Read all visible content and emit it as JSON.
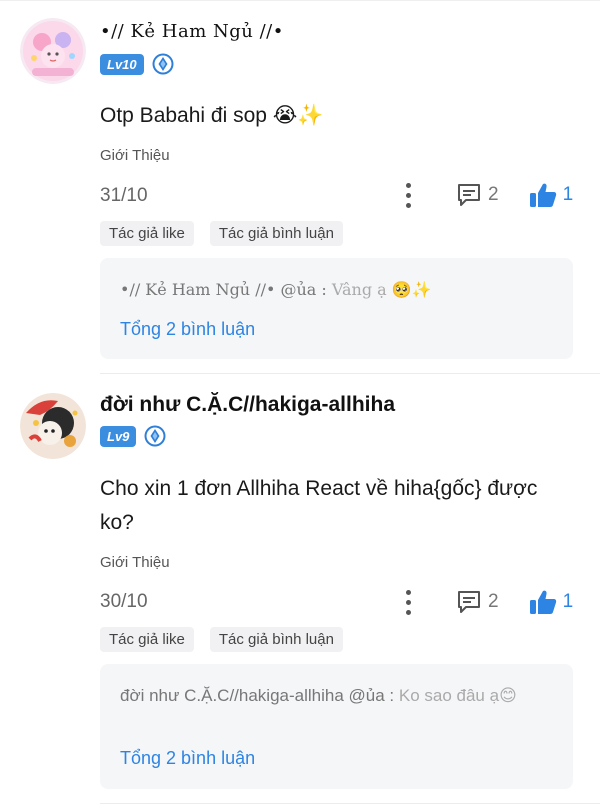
{
  "comments": [
    {
      "username": "•// Kẻ Ham Ngủ //•",
      "level": "Lv10",
      "content": "Otp Babahi đi sop 😭✨",
      "intro": "Giới Thiệu",
      "date": "31/10",
      "comment_count": "2",
      "like_count": "1",
      "tags": [
        "Tác giả like",
        "Tác giả bình luận"
      ],
      "reply": {
        "user": "•// Kẻ Ham Ngủ //• @ủa",
        "separator": " : ",
        "text": "Vâng ạ 🥺✨",
        "total": "Tổng 2 bình luận"
      }
    },
    {
      "username": "đời như C.Ặ.C//hakiga-allhiha",
      "level": "Lv9",
      "content": "Cho xin 1 đơn Allhiha React về hiha{gốc} được ko?",
      "intro": "Giới Thiệu",
      "date": "30/10",
      "comment_count": "2",
      "like_count": "1",
      "tags": [
        "Tác giả like",
        "Tác giả bình luận"
      ],
      "reply": {
        "user": "đời như C.Ặ.C//hakiga-allhiha @ủa",
        "separator": " : ",
        "text": "Ko sao đâu ạ😊",
        "total": "Tổng 2 bình luận"
      }
    }
  ],
  "colors": {
    "accent": "#2d84e3",
    "level_badge": "#3b8de0",
    "reply_bg": "#f5f6f8",
    "tag_bg": "#f1f1f3"
  },
  "icons": {
    "more": "more-vertical-icon",
    "comment": "comment-icon",
    "like": "thumbs-up-icon",
    "shield": "shield-badge-icon"
  }
}
